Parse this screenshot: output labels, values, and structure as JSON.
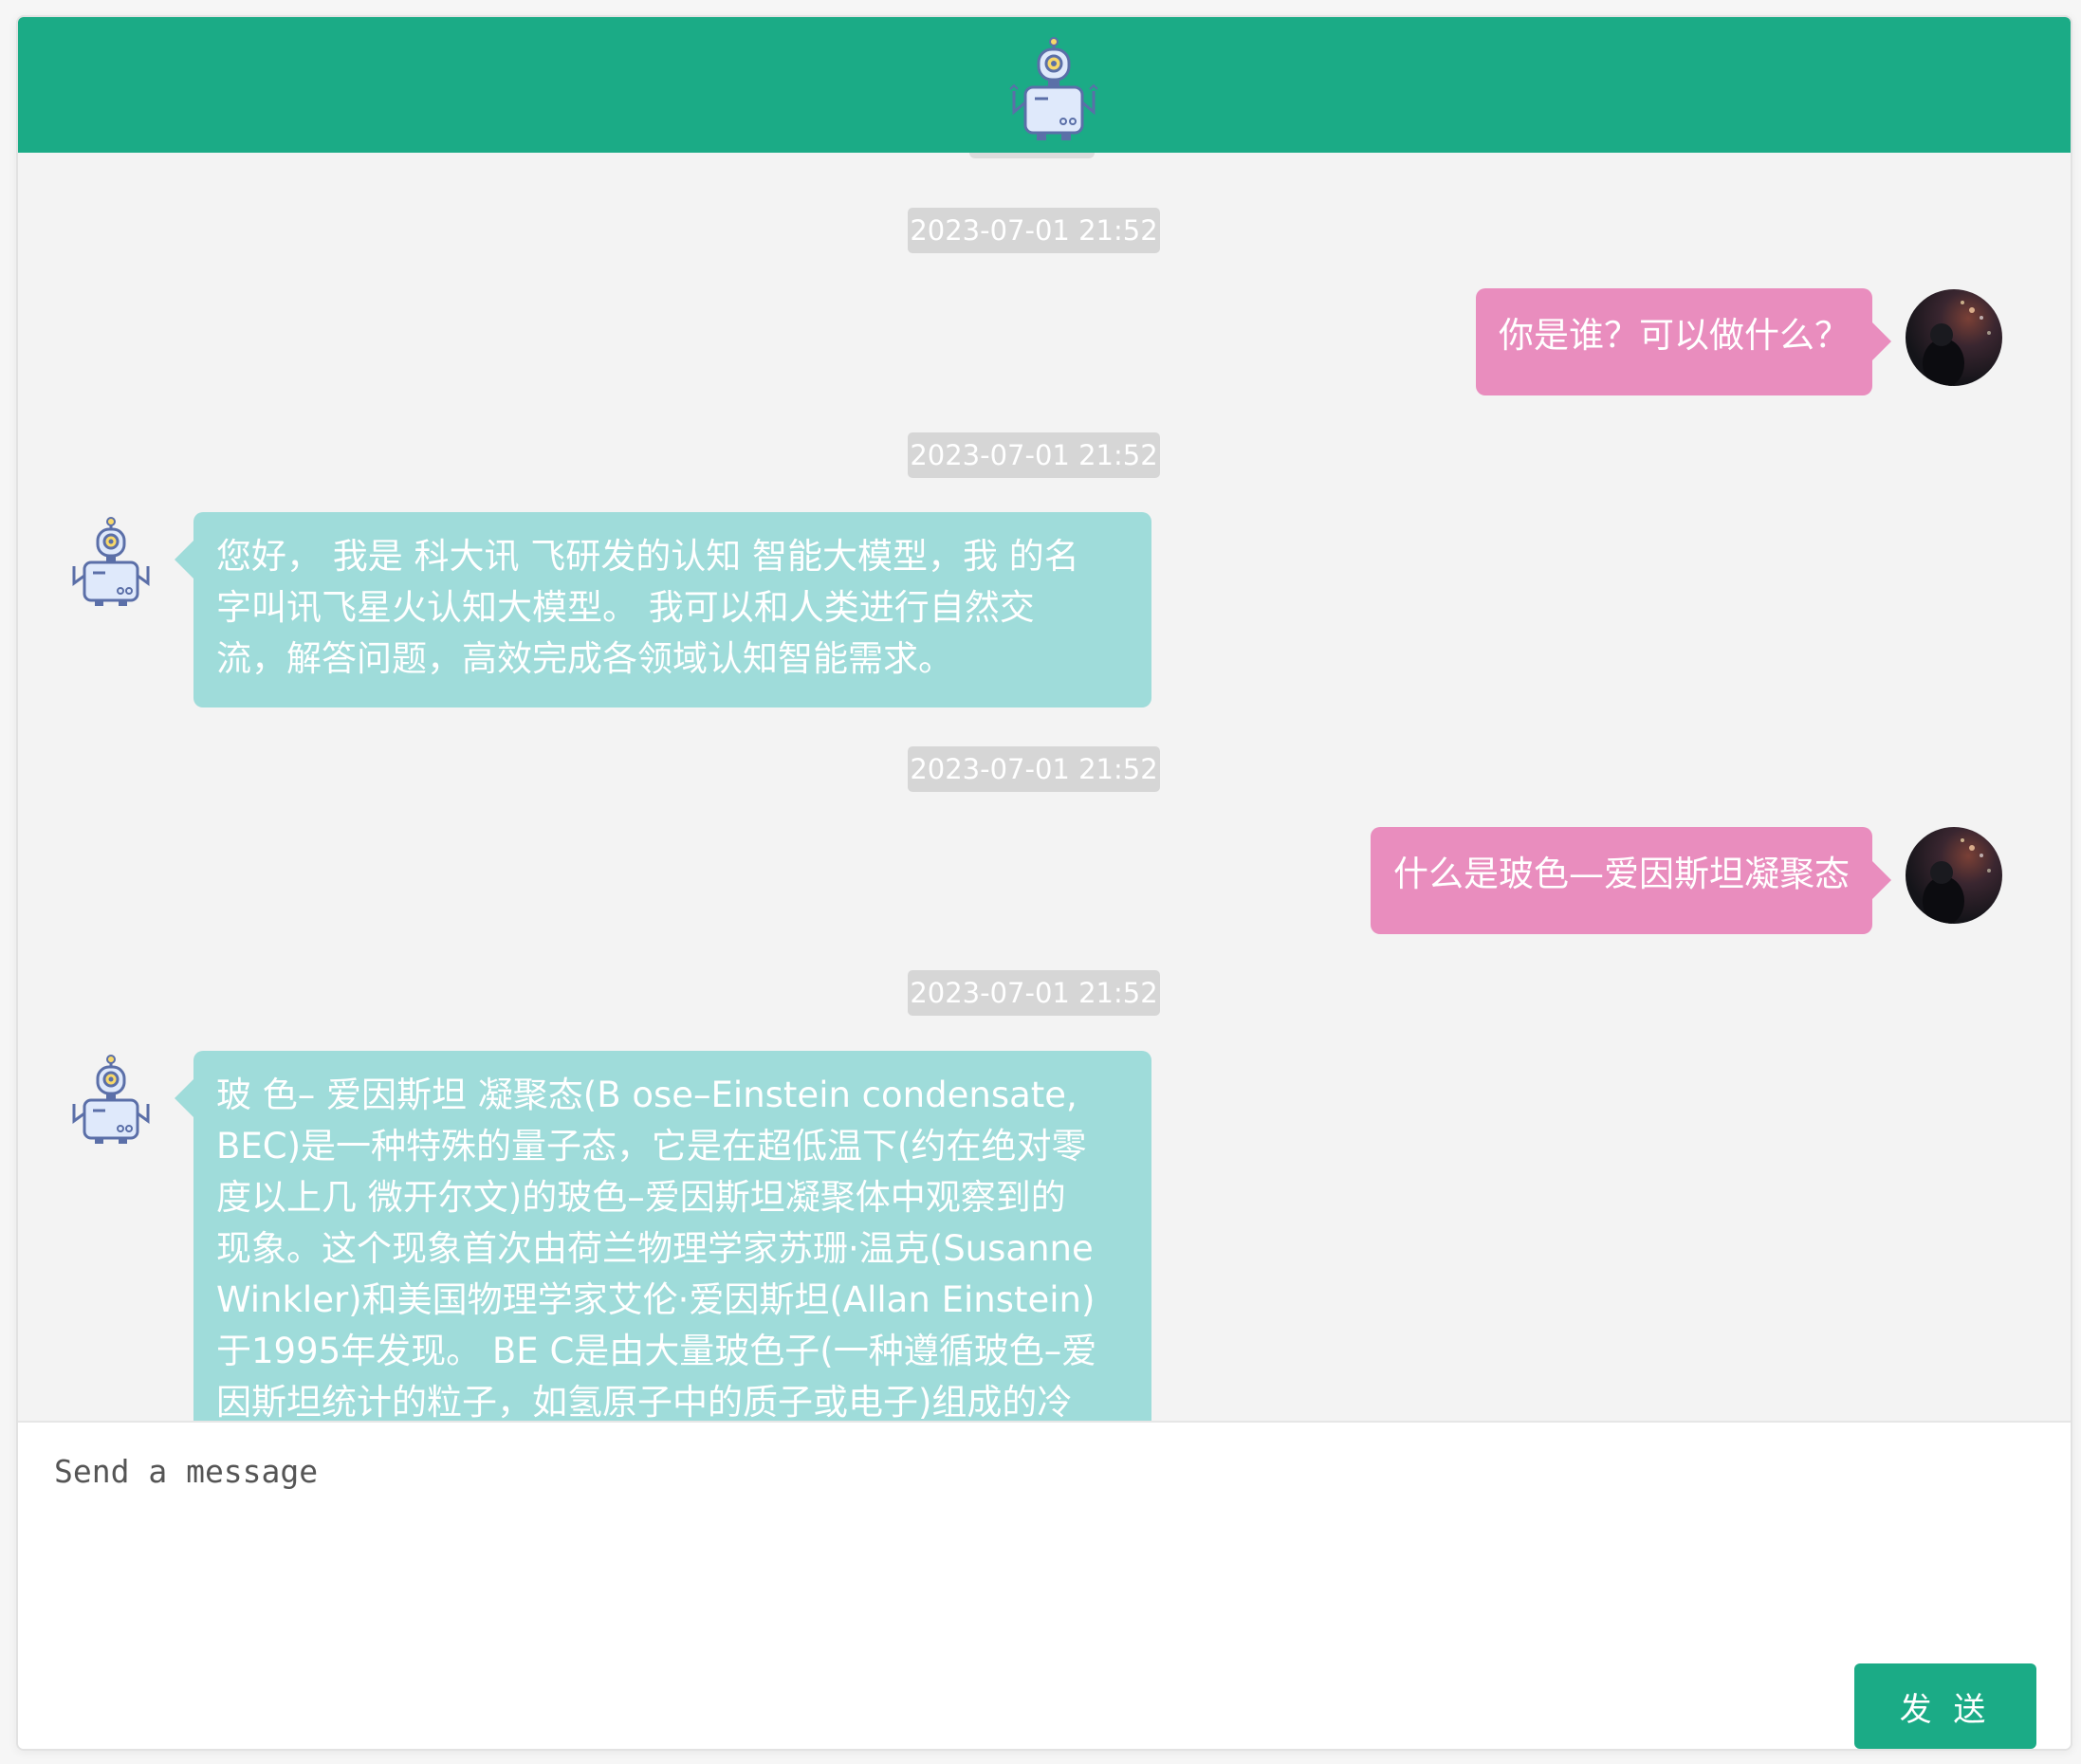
{
  "header": {
    "logo_icon": "robot-icon",
    "colors": {
      "header_bg": "#1bab86"
    }
  },
  "messages": [
    {
      "role": "time",
      "text": "2023-07-01 21:52"
    },
    {
      "role": "user",
      "text": "你是谁？可以做什么？"
    },
    {
      "role": "time",
      "text": "2023-07-01 21:52"
    },
    {
      "role": "bot",
      "lines": [
        "您好， 我是 科大讯 飞研发的认知 智能大模型，我 的名",
        "字叫讯飞星火认知大模型。 我可以和人类进行自然交",
        "流，解答问题，高效完成各领域认知智能需求。"
      ]
    },
    {
      "role": "time",
      "text": "2023-07-01 21:52"
    },
    {
      "role": "user",
      "text": "什么是玻色—爱因斯坦凝聚态"
    },
    {
      "role": "time",
      "text": "2023-07-01 21:52"
    },
    {
      "role": "bot",
      "lines": [
        "玻 色– 爱因斯坦 凝聚态(B ose–Einstein condensate,",
        "BEC)是一种特殊的量子态，它是在超低温下(约在绝对零",
        "度以上几 微开尔文)的玻色–爱因斯坦凝聚体中观察到的",
        "现象。这个现象首次由荷兰物理学家苏珊·温克(Susanne",
        "Winkler)和美国物理学家艾伦·爱因斯坦(Allan Einstein)",
        "于1995年发现。 BE C是由大量玻色子(一种遵循玻色–爱",
        "因斯坦统计的粒子，如氢原子中的质子或电子)组成的冷"
      ]
    }
  ],
  "composer": {
    "placeholder": "Send a message",
    "send_label": "发 送"
  },
  "colors": {
    "user_bubble": "#e98dbe",
    "bot_bubble": "#9fdcda",
    "accent": "#1bab86"
  }
}
